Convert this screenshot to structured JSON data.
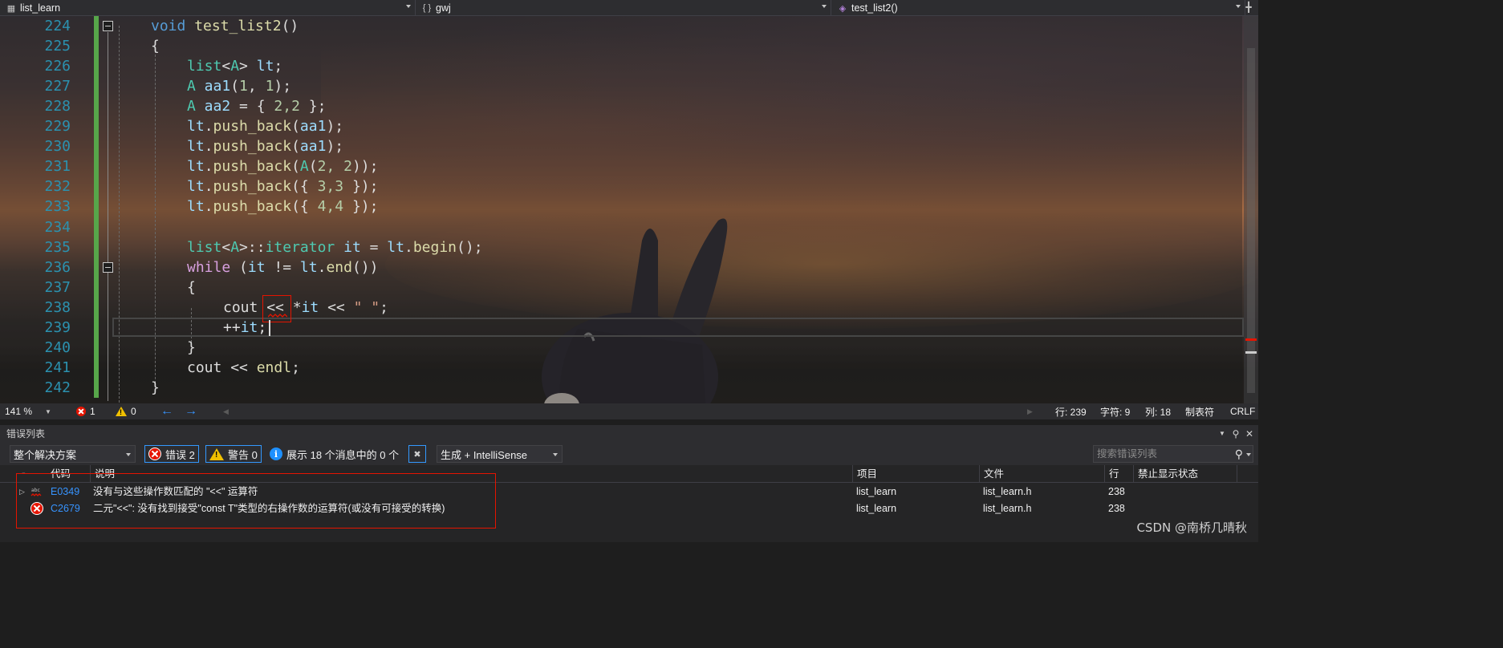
{
  "navbar": {
    "project": "list_learn",
    "scope": "gwj",
    "member": "test_list2()"
  },
  "editor": {
    "line_numbers": [
      "224",
      "225",
      "226",
      "227",
      "228",
      "229",
      "230",
      "231",
      "232",
      "233",
      "234",
      "235",
      "236",
      "237",
      "238",
      "239",
      "240",
      "241",
      "242"
    ],
    "code": {
      "l224_kw": "void",
      "l224_fn": "test_list2",
      "l224_p": "()",
      "l225": "{",
      "l226_ty": "list",
      "l226_p1": "<",
      "l226_ty2": "A",
      "l226_p2": "> ",
      "l226_id": "lt",
      "l226_p3": ";",
      "l227_ty": "A",
      "l227_id": " aa1",
      "l227_p": "(",
      "l227_n1": "1",
      "l227_p2": ", ",
      "l227_n2": "1",
      "l227_p3": ");",
      "l228_ty": "A",
      "l228_id": " aa2",
      "l228_p": " = { ",
      "l228_n": "2,2",
      "l228_p2": " };",
      "l229_id": "lt",
      "l229_p": ".",
      "l229_fn": "push_back",
      "l229_p2": "(",
      "l229_id2": "aa1",
      "l229_p3": ");",
      "l230_id": "lt",
      "l230_p": ".",
      "l230_fn": "push_back",
      "l230_p2": "(",
      "l230_id2": "aa1",
      "l230_p3": ");",
      "l231_id": "lt",
      "l231_p": ".",
      "l231_fn": "push_back",
      "l231_p2": "(",
      "l231_ty": "A",
      "l231_p3": "(",
      "l231_n": "2, 2",
      "l231_p4": "));",
      "l232_id": "lt",
      "l232_p": ".",
      "l232_fn": "push_back",
      "l232_p2": "({ ",
      "l232_n": "3,3",
      "l232_p3": " });",
      "l233_id": "lt",
      "l233_p": ".",
      "l233_fn": "push_back",
      "l233_p2": "({ ",
      "l233_n": "4,4",
      "l233_p3": " });",
      "l235_ty": "list",
      "l235_p1": "<",
      "l235_ty2": "A",
      "l235_p2": ">::",
      "l235_ty3": "iterator",
      "l235_id": " it",
      "l235_p3": " = ",
      "l235_id2": "lt",
      "l235_p4": ".",
      "l235_fn": "begin",
      "l235_p5": "();",
      "l236_kw": "while",
      "l236_p": " (",
      "l236_id": "it",
      "l236_p2": " != ",
      "l236_id2": "lt",
      "l236_p3": ".",
      "l236_fn": "end",
      "l236_p4": "())",
      "l237": "{",
      "l238_id": "cout",
      "l238_p": " << ",
      "l238_p2": "*",
      "l238_id2": "it",
      "l238_p3": " << ",
      "l238_st": "\" \"",
      "l238_p4": ";",
      "l239_p": "++",
      "l239_id": "it",
      "l239_p2": ";",
      "l240": "}",
      "l241_id": "cout",
      "l241_p": " << ",
      "l241_fn": "endl",
      "l241_p2": ";",
      "l242": "}"
    }
  },
  "status": {
    "zoom": "141 %",
    "errors": "1",
    "warnings": "0",
    "line": "行: 239",
    "char": "字符: 9",
    "col": "列: 18",
    "tabs": "制表符",
    "eol": "CRLF"
  },
  "errorlist": {
    "title": "错误列表",
    "scope": "整个解决方案",
    "errors_btn": "错误 2",
    "warnings_btn": "警告 0",
    "messages_btn": "展示 18 个消息中的 0 个",
    "build_filter": "生成 + IntelliSense",
    "search_placeholder": "搜索错误列表",
    "columns": {
      "code": "代码",
      "description": "说明",
      "project": "项目",
      "file": "文件",
      "line": "行",
      "suppression": "禁止显示状态"
    },
    "rows": [
      {
        "code": "E0349",
        "description": "没有与这些操作数匹配的 \"<<\" 运算符",
        "project": "list_learn",
        "file": "list_learn.h",
        "line": "238"
      },
      {
        "code": "C2679",
        "description": "二元\"<<\": 没有找到接受\"const T\"类型的右操作数的运算符(或没有可接受的转换)",
        "project": "list_learn",
        "file": "list_learn.h",
        "line": "238"
      }
    ]
  },
  "watermark": "CSDN @南桥几晴秋"
}
